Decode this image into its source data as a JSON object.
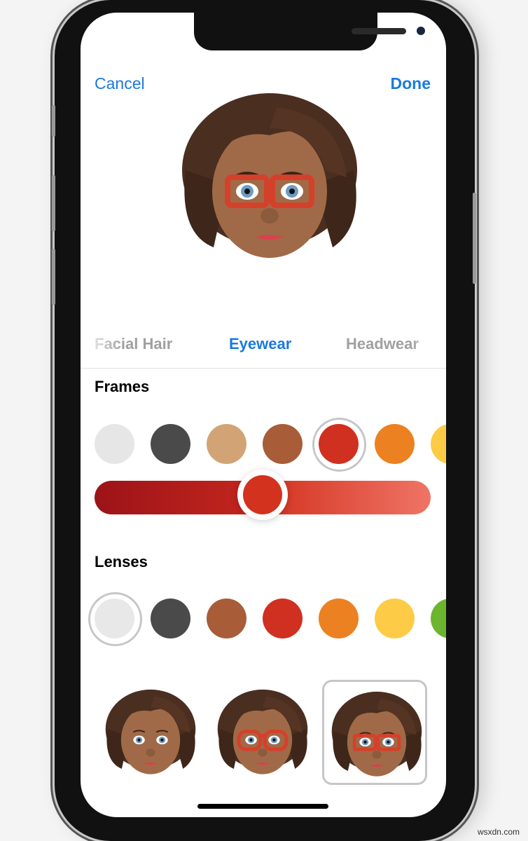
{
  "header": {
    "cancel_label": "Cancel",
    "done_label": "Done"
  },
  "categories": {
    "tabs": [
      {
        "label": "Facial Hair",
        "active": false
      },
      {
        "label": "Eyewear",
        "active": true
      },
      {
        "label": "Headwear",
        "active": false
      }
    ]
  },
  "frames": {
    "title": "Frames",
    "colors": [
      "#e6e6e6",
      "#4a4a4a",
      "#d2a475",
      "#a85c38",
      "#d0301f",
      "#ec8121",
      "#fdcb45"
    ],
    "selected_index": 4,
    "shade_slider_value": 0.5,
    "slider_gradient": [
      "#9c1318",
      "#ef7465"
    ]
  },
  "lenses": {
    "title": "Lenses",
    "colors": [
      "#e8e8e8",
      "#4a4a4a",
      "#a85c38",
      "#d0301f",
      "#ec8121",
      "#fdcb45",
      "#6cb52e"
    ],
    "selected_index": 0
  },
  "styles": {
    "options": [
      "no-glasses",
      "round-red-glasses",
      "rectangular-red-glasses"
    ],
    "selected_index": 2
  },
  "accent_color": "#1a7ae0",
  "watermark": "wsxdn.com"
}
